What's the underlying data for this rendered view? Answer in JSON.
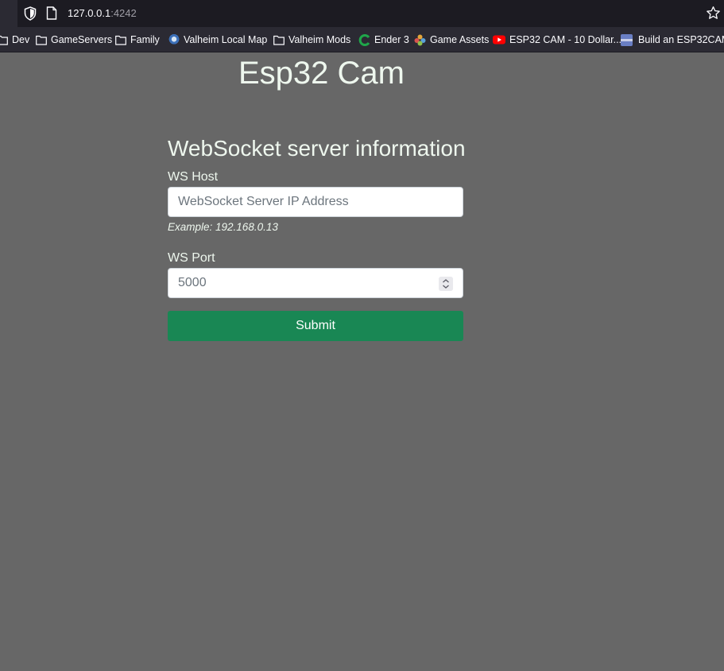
{
  "browser": {
    "url_host": "127.0.0.1",
    "url_port": ":4242",
    "bookmarks": [
      {
        "label": "Dev",
        "icon": "folder-icon"
      },
      {
        "label": "GameServers",
        "icon": "folder-icon"
      },
      {
        "label": "Family",
        "icon": "folder-icon"
      },
      {
        "label": "Valheim Local Map",
        "icon": "valheim-favicon"
      },
      {
        "label": "Valheim Mods",
        "icon": "folder-icon"
      },
      {
        "label": "Ender 3",
        "icon": "creality-favicon"
      },
      {
        "label": "Game Assets",
        "icon": "game-assets-favicon"
      },
      {
        "label": "ESP32 CAM - 10 Dollar...",
        "icon": "youtube-favicon"
      },
      {
        "label": "Build an ESP32CAM",
        "icon": "site-favicon"
      }
    ]
  },
  "page": {
    "title": "Esp32 Cam",
    "section_title": "WebSocket server information",
    "host_label": "WS Host",
    "host_placeholder": "WebSocket Server IP Address",
    "host_hint": "Example: 192.168.0.13",
    "port_label": "WS Port",
    "port_value": "5000",
    "submit_label": "Submit"
  },
  "colors": {
    "page_background": "#676767",
    "text": "#eef7ee",
    "submit_button": "#198754"
  }
}
